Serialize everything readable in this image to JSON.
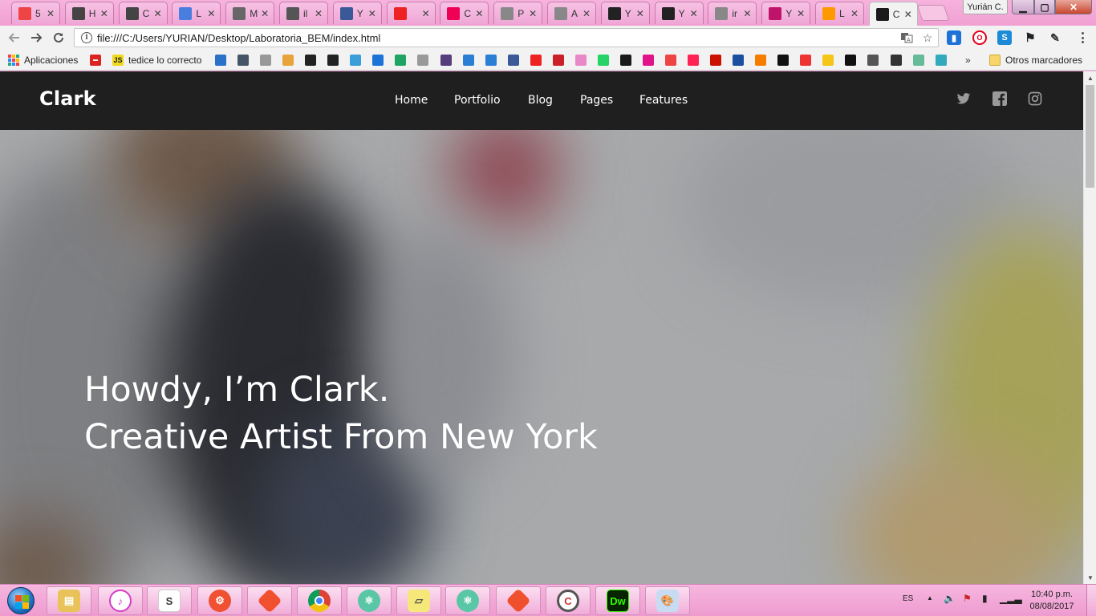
{
  "tabs": [
    {
      "title": "5",
      "icon": "f-icon",
      "color": "#e44"
    },
    {
      "title": "H",
      "icon": "codepen-icon",
      "color": "#444"
    },
    {
      "title": "C",
      "icon": "codepen-icon",
      "color": "#444"
    },
    {
      "title": "L",
      "icon": "doc-icon",
      "color": "#4a7de0"
    },
    {
      "title": "M",
      "icon": "pen-icon",
      "color": "#666"
    },
    {
      "title": "il",
      "icon": "triangle-icon",
      "color": "#555"
    },
    {
      "title": "Y",
      "icon": "facebook-icon",
      "color": "#3b5998"
    },
    {
      "title": "",
      "icon": "youtube-icon",
      "color": "#e22"
    },
    {
      "title": "C",
      "icon": "wave-icon",
      "color": "#e05"
    },
    {
      "title": "P",
      "icon": "page-icon",
      "color": "#888"
    },
    {
      "title": "A",
      "icon": "page-icon",
      "color": "#888"
    },
    {
      "title": "Y",
      "icon": "github-icon",
      "color": "#222"
    },
    {
      "title": "Y",
      "icon": "github-icon",
      "color": "#222"
    },
    {
      "title": "ir",
      "icon": "page-icon",
      "color": "#888"
    },
    {
      "title": "Y",
      "icon": "glitch-icon",
      "color": "#c0146a"
    },
    {
      "title": "L",
      "icon": "amazon-icon",
      "color": "#f90"
    },
    {
      "title": "C",
      "icon": "circle-icon",
      "color": "#1a1a1a",
      "active": true
    }
  ],
  "window": {
    "user": "Yurián C."
  },
  "address": {
    "url": "file:///C:/Users/YURIAN/Desktop/Laboratoria_BEM/index.html"
  },
  "bookmarks": {
    "apps_label": "Aplicaciones",
    "js_label": "tedice lo correcto",
    "more": "»",
    "other_label": "Otros marcadores"
  },
  "site": {
    "brand": "Clark",
    "nav": [
      {
        "label": "Home"
      },
      {
        "label": "Portfolio"
      },
      {
        "label": "Blog"
      },
      {
        "label": "Pages"
      },
      {
        "label": "Features"
      }
    ],
    "social": [
      "twitter-icon",
      "facebook-icon",
      "instagram-icon"
    ],
    "hero_line1": "Howdy, I’m Clark.",
    "hero_line2": "Creative Artist From New York"
  },
  "taskbar": {
    "lang": "ES",
    "time": "10:40 p.m.",
    "date": "08/08/2017"
  },
  "colors": {
    "header_bg": "#1f1f1f",
    "hero_bg": "#a7a9ab",
    "taskbar_pink": "#f19fd3"
  }
}
